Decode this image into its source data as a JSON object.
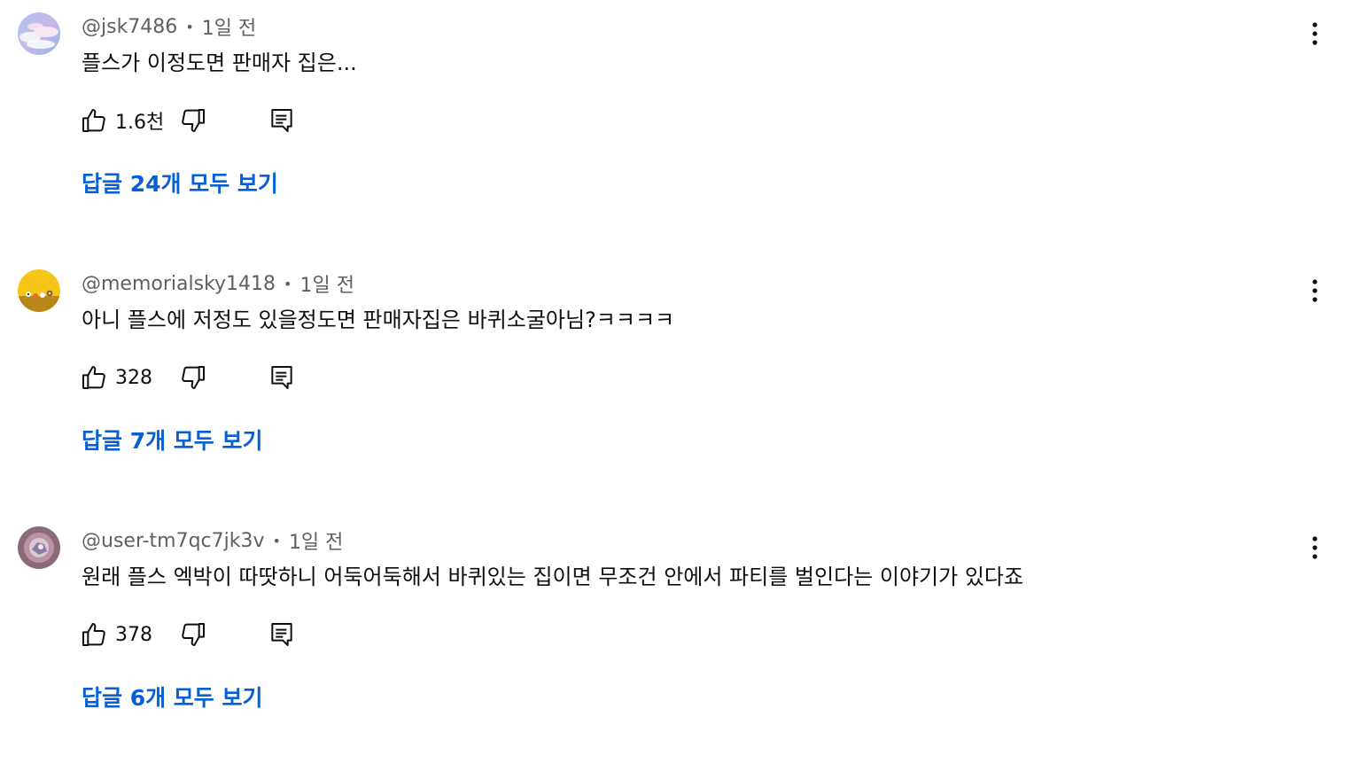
{
  "comments": [
    {
      "handle": "@jsk7486",
      "separator": "•",
      "time": "1일 전",
      "text": "플스가 이정도면 판매자 집은...",
      "likes": "1.6천",
      "replies_label": "답글 24개 모두 보기",
      "avatar_icon": "sky-clouds-avatar"
    },
    {
      "handle": "@memorialsky1418",
      "separator": "•",
      "time": "1일 전",
      "text": "아니 플스에 저정도 있을정도면 판매자집은 바퀴소굴아님?ㅋㅋㅋㅋ",
      "likes": "328",
      "replies_label": "답글 7개 모두 보기",
      "avatar_icon": "yellow-characters-avatar"
    },
    {
      "handle": "@user-tm7qc7jk3v",
      "separator": "•",
      "time": "1일 전",
      "text": "원래 플스 엑박이 따땃하니 어둑어둑해서 바퀴있는 집이면 무조건 안에서 파티를 벌인다는 이야기가 있다죠",
      "likes": "378",
      "replies_label": "답글 6개 모두 보기",
      "avatar_icon": "pink-gem-avatar"
    }
  ],
  "icons": {
    "like": "thumbs-up-icon",
    "dislike": "thumbs-down-icon",
    "reply": "reply-comment-icon",
    "more": "more-vertical-icon"
  },
  "colors": {
    "link": "#065fd4",
    "meta_text": "#606060",
    "body_text": "#0f0f0f"
  }
}
